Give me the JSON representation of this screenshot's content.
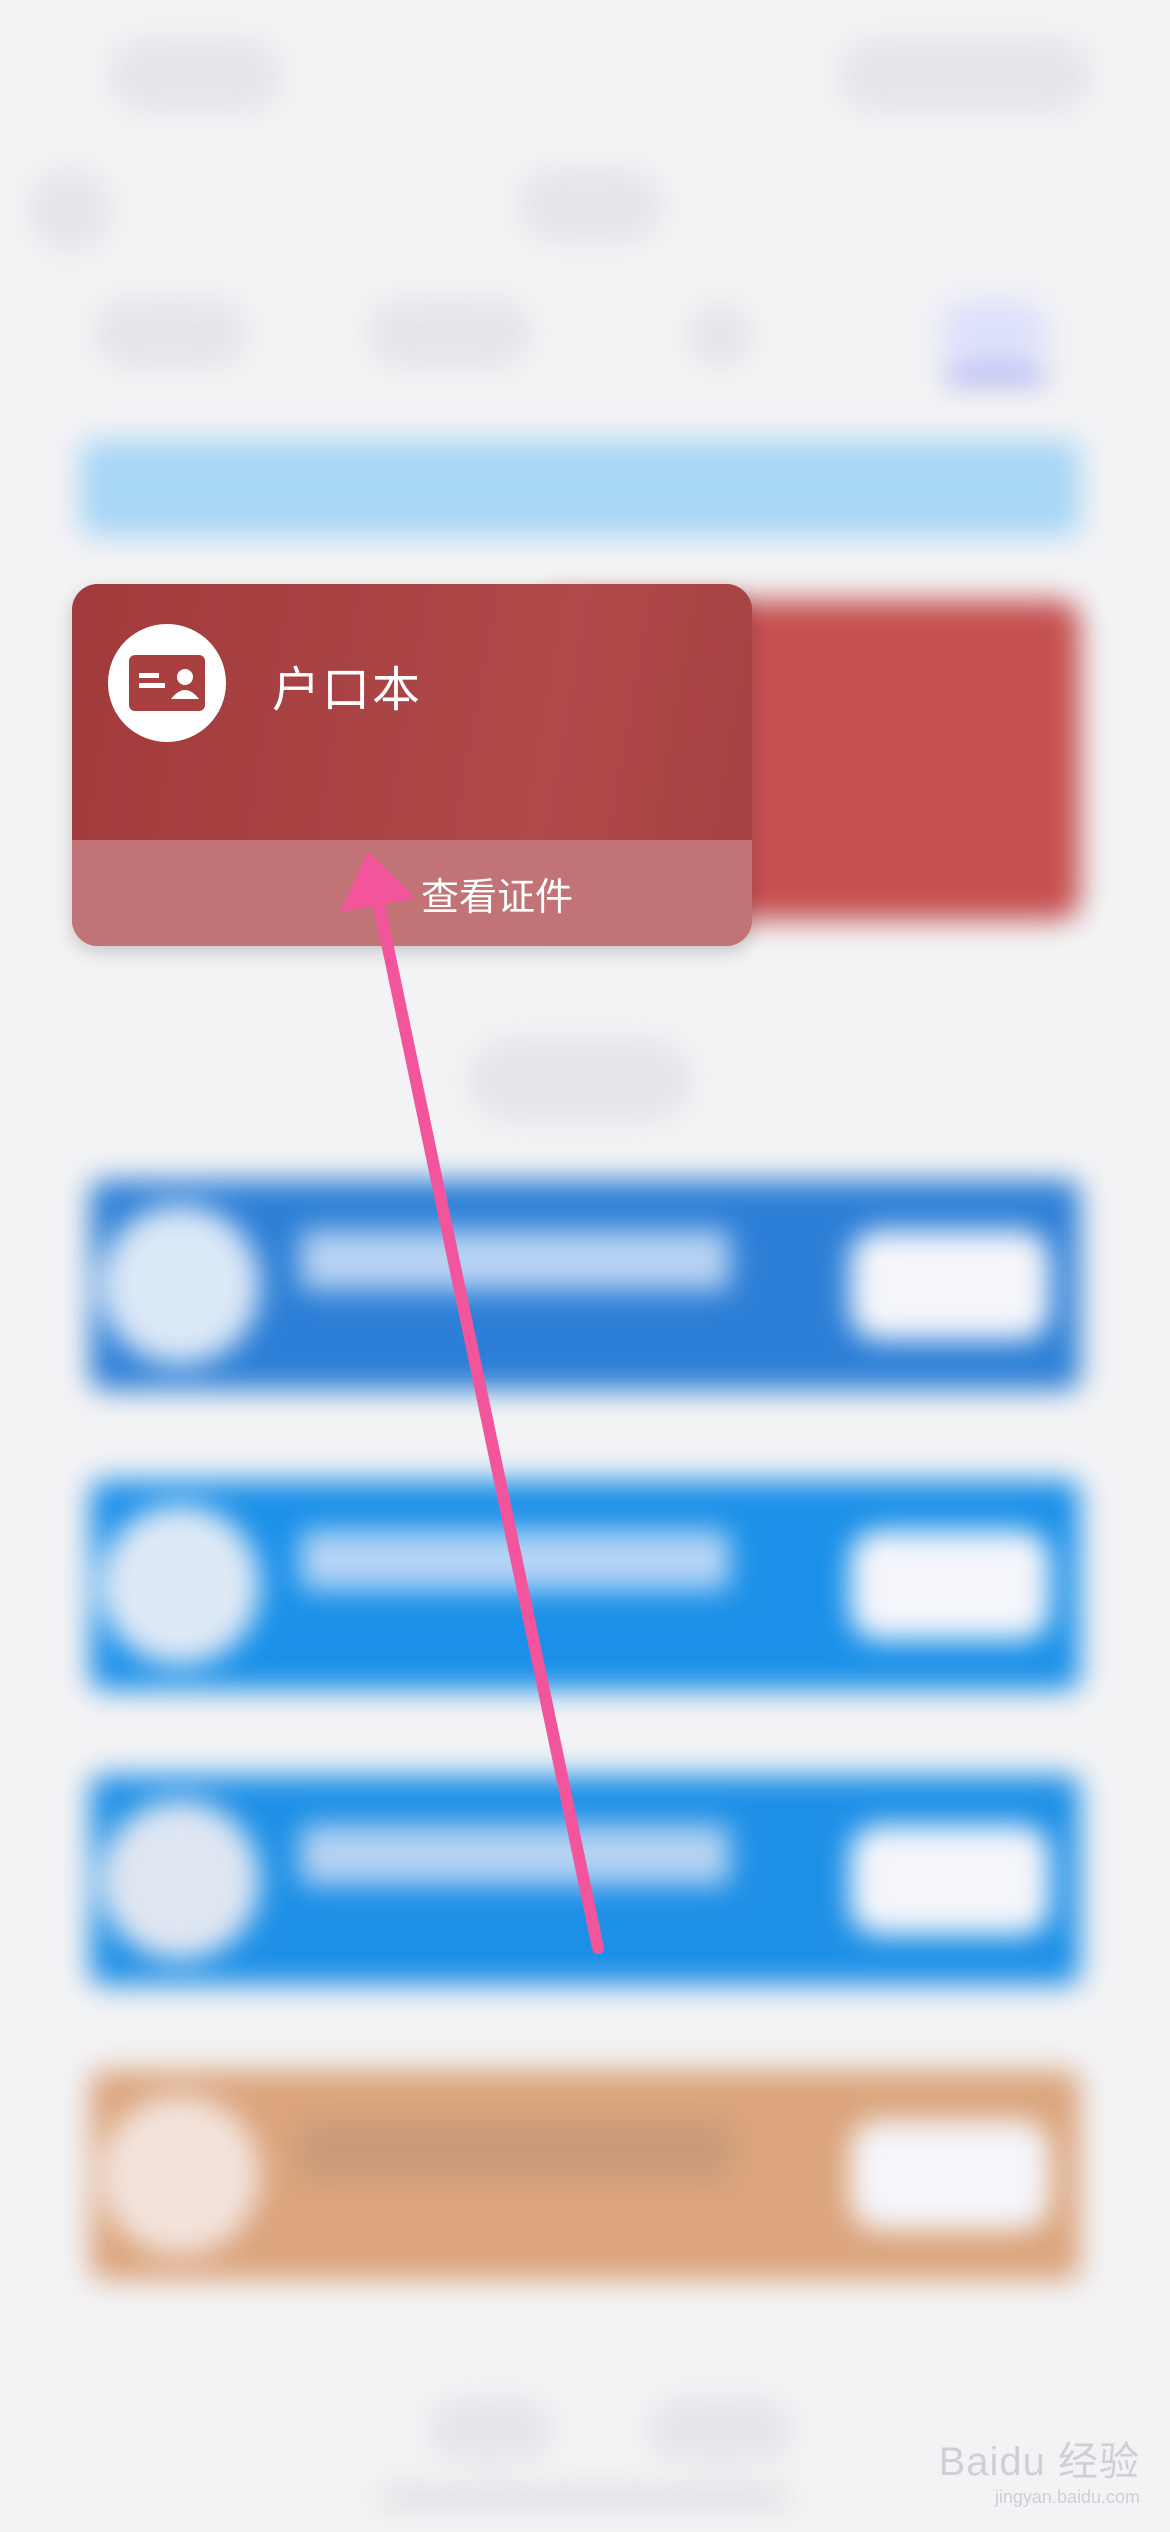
{
  "card": {
    "title": "户口本",
    "action_label": "查看证件"
  },
  "colors": {
    "card_red": "#a8403f",
    "card_bottom": "#c17375",
    "banner_blue": "#a8d6f5",
    "tile_blue": "#1a90e8",
    "tile_orange": "#dba47c",
    "arrow_pink": "#f2559c"
  },
  "icons": {
    "card_icon": "id-card-icon",
    "back": "back-arrow-icon"
  },
  "watermark": {
    "brand": "Baidu 经验",
    "url": "jingyan.baidu.com"
  }
}
